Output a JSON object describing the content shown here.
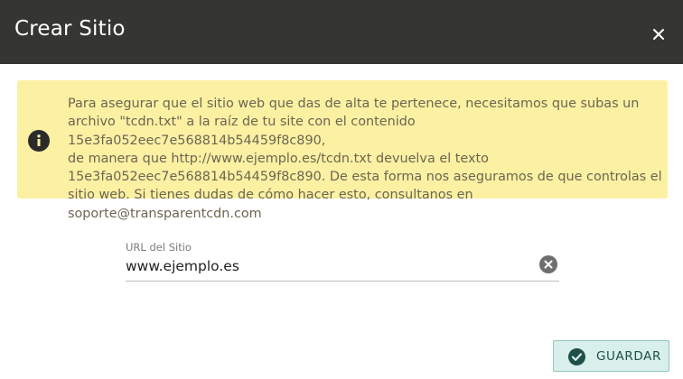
{
  "dialog": {
    "title": "Crear Sitio",
    "close_icon": "close-icon"
  },
  "notice": {
    "icon": "info-icon",
    "text": "Para asegurar que el sitio web que das de alta te pertenece, necesitamos que subas un\narchivo \"tcdn.txt\" a la raíz de tu site con el contenido 15e3fa052eec7e568814b54459f8c890,\nde manera que http://www.ejemplo.es/tcdn.txt devuelva el texto\n15e3fa052eec7e568814b54459f8c890. De esta forma nos aseguramos de que controlas el\nsitio web. Si tienes dudas de cómo hacer esto, consultanos en soporte@transparentcdn.com"
  },
  "url_field": {
    "label": "URL del Sitio",
    "value": "www.ejemplo.es",
    "clear_icon": "clear-icon"
  },
  "actions": {
    "save_label": "GUARDAR",
    "save_icon": "check-circle-icon"
  },
  "colors": {
    "header_bg": "#353532",
    "notice_bg": "#fcf0a3",
    "button_bg": "#d9efeb",
    "button_border": "#8ec8be"
  }
}
